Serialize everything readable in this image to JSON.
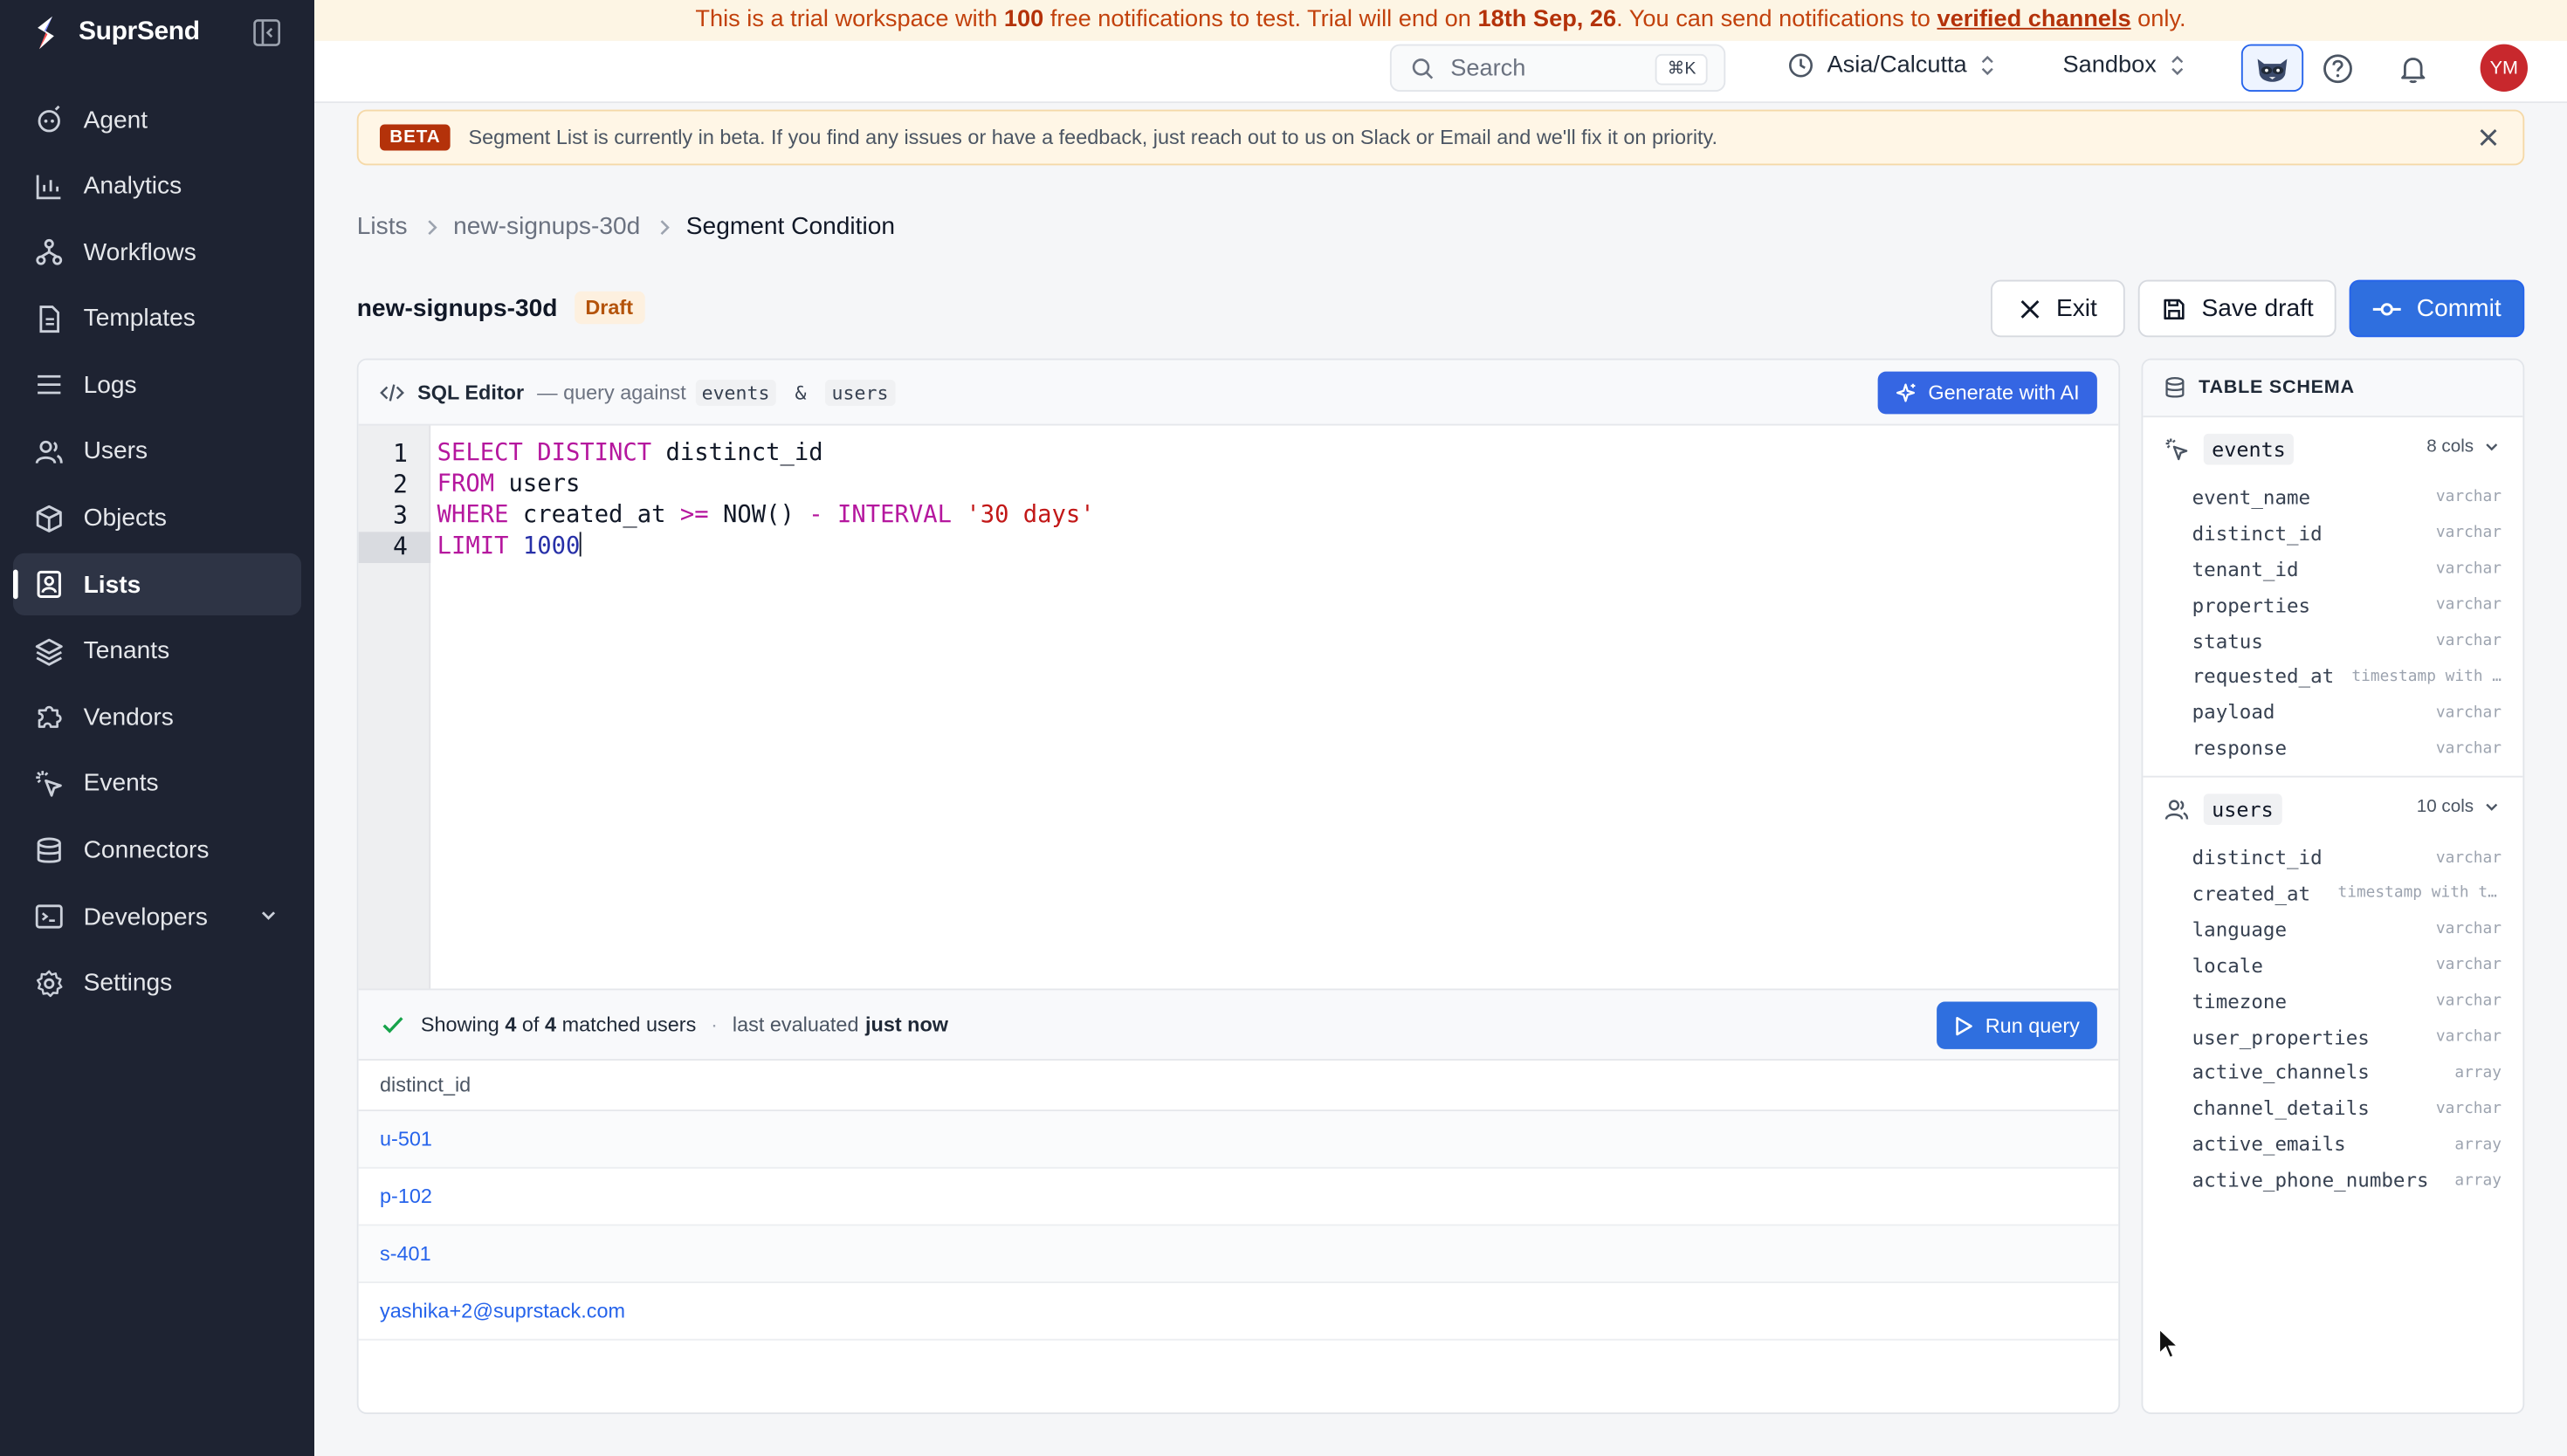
{
  "app": {
    "name": "SuprSend"
  },
  "sidebar": {
    "items": [
      {
        "label": "Agent",
        "icon": "agent-icon"
      },
      {
        "label": "Analytics",
        "icon": "bar-chart-icon"
      },
      {
        "label": "Workflows",
        "icon": "workflow-icon"
      },
      {
        "label": "Templates",
        "icon": "template-icon"
      },
      {
        "label": "Logs",
        "icon": "list-icon"
      },
      {
        "label": "Users",
        "icon": "users-icon"
      },
      {
        "label": "Objects",
        "icon": "cube-icon"
      },
      {
        "label": "Lists",
        "icon": "contact-list-icon",
        "active": true
      },
      {
        "label": "Tenants",
        "icon": "stack-icon"
      },
      {
        "label": "Vendors",
        "icon": "puzzle-icon"
      },
      {
        "label": "Events",
        "icon": "pointer-click-icon"
      },
      {
        "label": "Connectors",
        "icon": "database-icon"
      },
      {
        "label": "Developers",
        "icon": "terminal-icon"
      },
      {
        "label": "Settings",
        "icon": "gear-icon"
      }
    ]
  },
  "trial_banner": {
    "part1": "This is a trial workspace with ",
    "count": "100",
    "part2": " free notifications to test. Trial will end on ",
    "end_date": "18th Sep, 26",
    "part3": ". You can send notifications to ",
    "link": "verified channels",
    "part4": " only."
  },
  "topbar": {
    "search_label": "Search",
    "search_shortcut": "⌘K",
    "timezone": "Asia/Calcutta",
    "environment": "Sandbox",
    "avatar_initials": "YM"
  },
  "beta_banner": {
    "badge": "BETA",
    "text": "Segment List is currently in beta. If you find any issues or have a feedback, just reach out to us on Slack or Email and we'll fix it on priority."
  },
  "breadcrumb": [
    "Lists",
    "new-signups-30d",
    "Segment Condition"
  ],
  "header": {
    "title": "new-signups-30d",
    "status": "Draft",
    "exit_label": "Exit",
    "save_label": "Save draft",
    "commit_label": "Commit"
  },
  "editor": {
    "title": "SQL Editor",
    "subtitle_prefix": "— query against",
    "table_a": "events",
    "amp": "&",
    "table_b": "users",
    "generate_label": "Generate with AI",
    "line_numbers": [
      "1",
      "2",
      "3",
      "4"
    ],
    "code": {
      "l1_kw": "SELECT DISTINCT",
      "l1_rest": " distinct_id",
      "l2_kw": "FROM",
      "l2_rest": " users",
      "l3_kw": "WHERE",
      "l3_col": " created_at ",
      "l3_op": ">=",
      "l3_fn": " NOW() ",
      "l3_minus": "-",
      "l3_interval": " INTERVAL ",
      "l3_str": "'30 days'",
      "l4_kw": "LIMIT",
      "l4_num": " 1000"
    }
  },
  "results": {
    "showing": "Showing",
    "matched": "4",
    "of": "of",
    "total": "4",
    "suffix": "matched users",
    "evaluated_prefix": "last evaluated",
    "evaluated_when": "just now",
    "run_label": "Run query",
    "column": "distinct_id",
    "rows": [
      "u-501",
      "p-102",
      "s-401",
      "yashika+2@suprstack.com"
    ]
  },
  "schema": {
    "title": "TABLE SCHEMA",
    "tables": [
      {
        "name": "events",
        "count": "8 cols",
        "columns": [
          {
            "name": "event_name",
            "type": "varchar"
          },
          {
            "name": "distinct_id",
            "type": "varchar"
          },
          {
            "name": "tenant_id",
            "type": "varchar"
          },
          {
            "name": "properties",
            "type": "varchar"
          },
          {
            "name": "status",
            "type": "varchar"
          },
          {
            "name": "requested_at",
            "type": "timestamp with …"
          },
          {
            "name": "payload",
            "type": "varchar"
          },
          {
            "name": "response",
            "type": "varchar"
          }
        ]
      },
      {
        "name": "users",
        "count": "10 cols",
        "columns": [
          {
            "name": "distinct_id",
            "type": "varchar"
          },
          {
            "name": "created_at",
            "type": "timestamp with tim…"
          },
          {
            "name": "language",
            "type": "varchar"
          },
          {
            "name": "locale",
            "type": "varchar"
          },
          {
            "name": "timezone",
            "type": "varchar"
          },
          {
            "name": "user_properties",
            "type": "varchar"
          },
          {
            "name": "active_channels",
            "type": "array"
          },
          {
            "name": "channel_details",
            "type": "varchar"
          },
          {
            "name": "active_emails",
            "type": "array"
          },
          {
            "name": "active_phone_numbers",
            "type": "array"
          }
        ]
      }
    ]
  }
}
